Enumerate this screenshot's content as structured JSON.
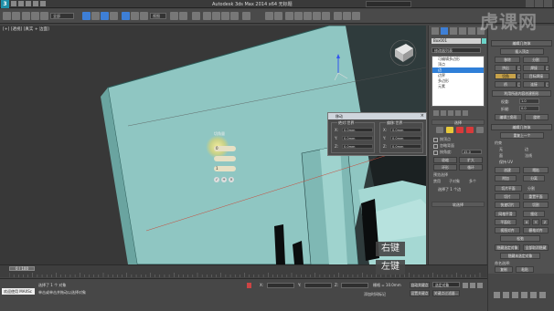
{
  "app": {
    "title": "Autodesk 3ds Max 2014 x64     无标题",
    "logo": "3"
  },
  "watermark": "虎课网",
  "toolbar": {
    "selection_filter": "全部",
    "ref_coord": "视图"
  },
  "viewport": {
    "label": "[+] [透视] [真实 + 边面]"
  },
  "gizmo": {
    "title": "切角量",
    "field_1": "0",
    "field_2": "",
    "field_3": "1"
  },
  "dialog": {
    "title": "移动",
    "left_group": "绝对:世界",
    "right_group": "偏移:世界",
    "rows_left": [
      {
        "axis": "X:",
        "value": "0.0mm"
      },
      {
        "axis": "Y:",
        "value": "0.0mm"
      },
      {
        "axis": "Z:",
        "value": "0.0mm"
      }
    ],
    "rows_right": [
      {
        "axis": "X:",
        "value": "0.0mm"
      },
      {
        "axis": "Y:",
        "value": "0.0mm"
      },
      {
        "axis": "Z:",
        "value": "0.0mm"
      }
    ],
    "close": "×"
  },
  "modifier_panel": {
    "object_name": "Box001",
    "modifier_list": "修改器列表",
    "stack": [
      {
        "label": "可编辑多边形",
        "selected": false
      },
      {
        "label": "顶点",
        "selected": false
      },
      {
        "label": "边",
        "selected": true
      },
      {
        "label": "边界",
        "selected": false
      },
      {
        "label": "多边形",
        "selected": false
      },
      {
        "label": "元素",
        "selected": false
      }
    ],
    "selection_header": "选择",
    "by_vertex": "按顶点",
    "ignore_backfacing": "忽略背面",
    "by_angle": "按角度:",
    "angle_value": "45.0",
    "shrink": "收缩",
    "grow": "扩大",
    "ring": "环形",
    "loop": "循环",
    "preview_selection": "预览选择",
    "preview_off": "禁用",
    "preview_sub": "子对象",
    "preview_multi": "多个",
    "selected_count": "选择了 1 个边",
    "soft_selection": "软选择"
  },
  "command_panel": {
    "edit_geometry_header": "编辑几何体",
    "insert_vertex": "插入顶点",
    "remove": "移除",
    "split": "分割",
    "extrude": "挤出",
    "weld": "焊接",
    "chamfer": "切角",
    "target_weld": "目标焊接",
    "bridge": "桥",
    "connect": "连接",
    "create_shape": "利用所选内容创建图形",
    "weight": "权重:",
    "crease": "折缝:",
    "weight_val": "1.0",
    "crease_val": "0.0",
    "edit_tri": "编辑三角形",
    "turn": "旋转",
    "edit_geo2": "编辑几何体",
    "repeat_last": "重复上一个",
    "constraints": "约束",
    "none": "无",
    "edge": "边",
    "face": "面",
    "normal": "法线",
    "preserve_uvs": "保持 UV",
    "create": "创建",
    "collapse": "塌陷",
    "attach": "附加",
    "detach": "分离",
    "slice_plane": "切片平面",
    "split_chk": "分割",
    "slice": "切片",
    "reset_plane": "重置平面",
    "quickslice": "快速切片",
    "cut": "切割",
    "meshsmooth": "网格平滑",
    "tessellate": "细化",
    "make_planar": "平面化",
    "x": "X",
    "y": "Y",
    "z": "Z",
    "view_align": "视图对齐",
    "grid_align": "栅格对齐",
    "relax": "松弛",
    "hide_sel": "隐藏选定对象",
    "unhide_all": "全部取消隐藏",
    "hide_unsel": "隐藏未选定对象",
    "named_sel": "命名选择:",
    "copy": "复制",
    "paste": "粘贴",
    "delete_iso": "删除孤立顶点"
  },
  "timeline": {
    "slider": "0 / 100",
    "ticks": [
      "0",
      "5",
      "10",
      "15",
      "20",
      "25",
      "30",
      "35",
      "40",
      "45",
      "50",
      "55",
      "60",
      "65",
      "70",
      "75",
      "80",
      "85",
      "90",
      "95",
      "100"
    ]
  },
  "status": {
    "maxscript": "欢迎使用 MAXSc",
    "line1": "选择了 1 个 对象",
    "line2": "单击或单击并拖动以选择对象",
    "x": "X:",
    "y": "Y:",
    "z": "Z:",
    "grid": "栅格 = 10.0mm",
    "auto_key": "自动关键点",
    "set_key": "设置关键点",
    "selected": "选定对象",
    "key_filters": "关键点过滤器...",
    "add_time_tag": "添加时间标记"
  },
  "key_hints": {
    "right": "右键",
    "left": "左键"
  },
  "colors": {
    "mesh_face": "#8fc6c2",
    "mesh_dark": "#2f3b3c",
    "selection_blue": "#2f7fd8",
    "yellow_icon": "#e8c93a",
    "red_icon": "#d83a3a"
  }
}
